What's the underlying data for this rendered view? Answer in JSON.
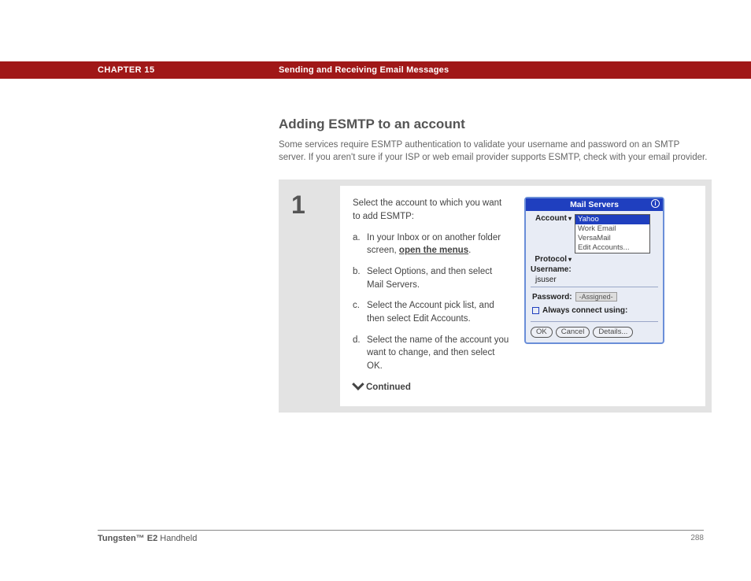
{
  "header": {
    "chapter": "CHAPTER 15",
    "title": "Sending and Receiving Email Messages"
  },
  "section": {
    "heading": "Adding ESMTP to an account",
    "intro": "Some services require ESMTP authentication to validate your username and password on an SMTP server. If you aren't sure if your ISP or web email provider supports ESMTP, check with your email provider."
  },
  "step": {
    "number": "1",
    "lead": "Select the account to which you want to add ESMTP:",
    "subs": [
      {
        "label": "a.",
        "pre": "In your Inbox or on another folder screen, ",
        "link": "open the menus",
        "post": "."
      },
      {
        "label": "b.",
        "text": "Select Options, and then select Mail Servers."
      },
      {
        "label": "c.",
        "text": "Select the Account pick list, and then select Edit Accounts."
      },
      {
        "label": "d.",
        "text": "Select the name of the account you want to change, and then select OK."
      }
    ],
    "continued": "Continued"
  },
  "device": {
    "title": "Mail Servers",
    "info": "i",
    "labels": {
      "account": "Account",
      "protocol": "Protocol",
      "username": "Username:",
      "username_value": "jsuser",
      "password": "Password:",
      "password_value": "-Assigned-",
      "always": "Always connect using:"
    },
    "picklist": [
      "Yahoo",
      "Work Email",
      "VersaMail",
      "Edit Accounts..."
    ],
    "buttons": {
      "ok": "OK",
      "cancel": "Cancel",
      "details": "Details..."
    }
  },
  "footer": {
    "product_bold": "Tungsten™ E2",
    "product_rest": " Handheld",
    "page": "288"
  }
}
